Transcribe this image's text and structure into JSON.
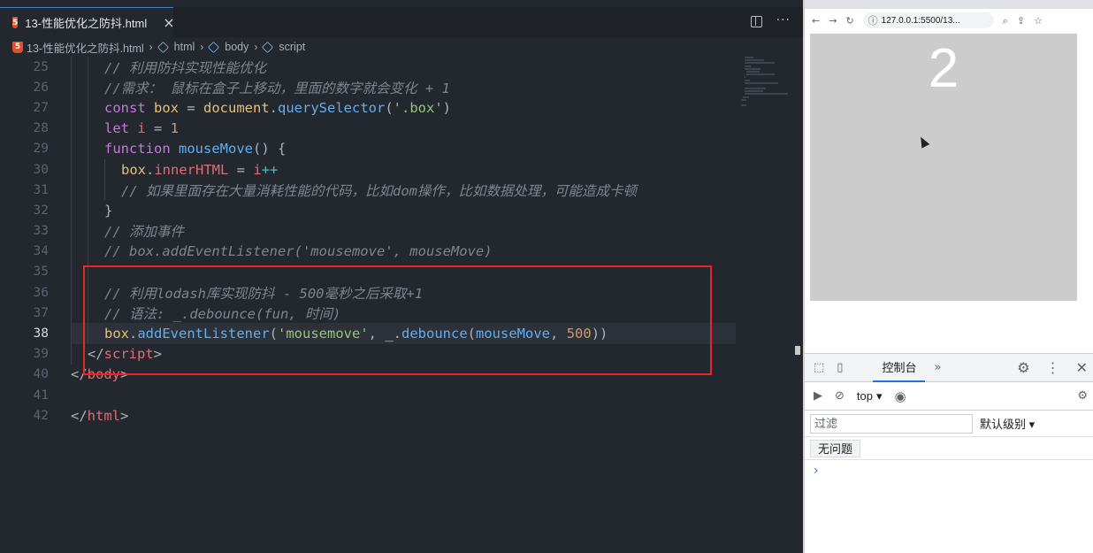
{
  "editor": {
    "tab_label": "13-性能优化之防抖.html",
    "tab_close": "×",
    "more_icon": "···",
    "breadcrumb": [
      "13-性能优化之防抖.html",
      "html",
      "body",
      "script"
    ]
  },
  "code_lines": [
    {
      "n": "25",
      "indent": 2,
      "tokens": [
        [
          "c",
          "// 利用防抖实现性能优化"
        ]
      ]
    },
    {
      "n": "26",
      "indent": 2,
      "tokens": [
        [
          "c",
          "//需求： 鼠标在盒子上移动，里面的数字就会变化 + 1"
        ]
      ]
    },
    {
      "n": "27",
      "indent": 2,
      "tokens": [
        [
          "k",
          "const "
        ],
        [
          "v",
          "box"
        ],
        [
          "t",
          " = "
        ],
        [
          "v",
          "document"
        ],
        [
          "t",
          "."
        ],
        [
          "f",
          "querySelector"
        ],
        [
          "t",
          "("
        ],
        [
          "s",
          "'.box'"
        ],
        [
          "t",
          ")"
        ]
      ]
    },
    {
      "n": "28",
      "indent": 2,
      "tokens": [
        [
          "k",
          "let "
        ],
        [
          "p",
          "i"
        ],
        [
          "t",
          " = "
        ],
        [
          "n",
          "1"
        ]
      ]
    },
    {
      "n": "29",
      "indent": 2,
      "tokens": [
        [
          "k",
          "function "
        ],
        [
          "f",
          "mouseMove"
        ],
        [
          "t",
          "() {"
        ]
      ]
    },
    {
      "n": "30",
      "indent": 3,
      "tokens": [
        [
          "v",
          "box"
        ],
        [
          "t",
          "."
        ],
        [
          "p",
          "innerHTML"
        ],
        [
          "t",
          " = "
        ],
        [
          "p",
          "i"
        ],
        [
          "o",
          "++"
        ]
      ]
    },
    {
      "n": "31",
      "indent": 3,
      "tokens": [
        [
          "c",
          "// 如果里面存在大量消耗性能的代码，比如dom操作，比如数据处理，可能造成卡顿"
        ]
      ]
    },
    {
      "n": "32",
      "indent": 2,
      "tokens": [
        [
          "t",
          "}"
        ]
      ]
    },
    {
      "n": "33",
      "indent": 2,
      "tokens": [
        [
          "c",
          "// 添加事件"
        ]
      ]
    },
    {
      "n": "34",
      "indent": 2,
      "tokens": [
        [
          "c",
          "// box.addEventListener('mousemove', mouseMove)"
        ]
      ]
    },
    {
      "n": "35",
      "indent": 2,
      "tokens": []
    },
    {
      "n": "36",
      "indent": 2,
      "tokens": [
        [
          "c",
          "// 利用lodash库实现防抖 - 500毫秒之后采取+1"
        ]
      ]
    },
    {
      "n": "37",
      "indent": 2,
      "tokens": [
        [
          "c",
          "// 语法: _.debounce(fun, 时间)"
        ]
      ]
    },
    {
      "n": "38",
      "indent": 2,
      "active": true,
      "tokens": [
        [
          "v",
          "box"
        ],
        [
          "t",
          "."
        ],
        [
          "f",
          "addEventListener"
        ],
        [
          "t",
          "("
        ],
        [
          "s",
          "'mousemove'"
        ],
        [
          "t",
          ", "
        ],
        [
          "v",
          "_"
        ],
        [
          "t",
          "."
        ],
        [
          "f",
          "debounce"
        ],
        [
          "t",
          "("
        ],
        [
          "f",
          "mouseMove"
        ],
        [
          "t",
          ", "
        ],
        [
          "n",
          "500"
        ],
        [
          "t",
          ")"
        ],
        [
          "t",
          ")"
        ]
      ]
    },
    {
      "n": "39",
      "indent": 1,
      "tokens": [
        [
          "t",
          "</"
        ],
        [
          "tag",
          "script"
        ],
        [
          "t",
          ">"
        ]
      ]
    },
    {
      "n": "40",
      "indent": 0,
      "tokens": [
        [
          "t",
          "</"
        ],
        [
          "tag",
          "body"
        ],
        [
          "t",
          ">"
        ]
      ]
    },
    {
      "n": "41",
      "indent": 0,
      "tokens": []
    },
    {
      "n": "42",
      "indent": 0,
      "tokens": [
        [
          "t",
          "</"
        ],
        [
          "tag",
          "html"
        ],
        [
          "t",
          ">"
        ]
      ]
    }
  ],
  "browser": {
    "url": "127.0.0.1:5500/13...",
    "box_value": "2"
  },
  "devtools": {
    "console_tab": "控制台",
    "context": "top",
    "filter_placeholder": "过滤",
    "level": "默认级别",
    "issues": "无问题",
    "prompt": "›"
  },
  "colors": {
    "editor_bg": "#23272e",
    "highlight_border": "#e8262a",
    "box_bg": "#cccccc"
  }
}
